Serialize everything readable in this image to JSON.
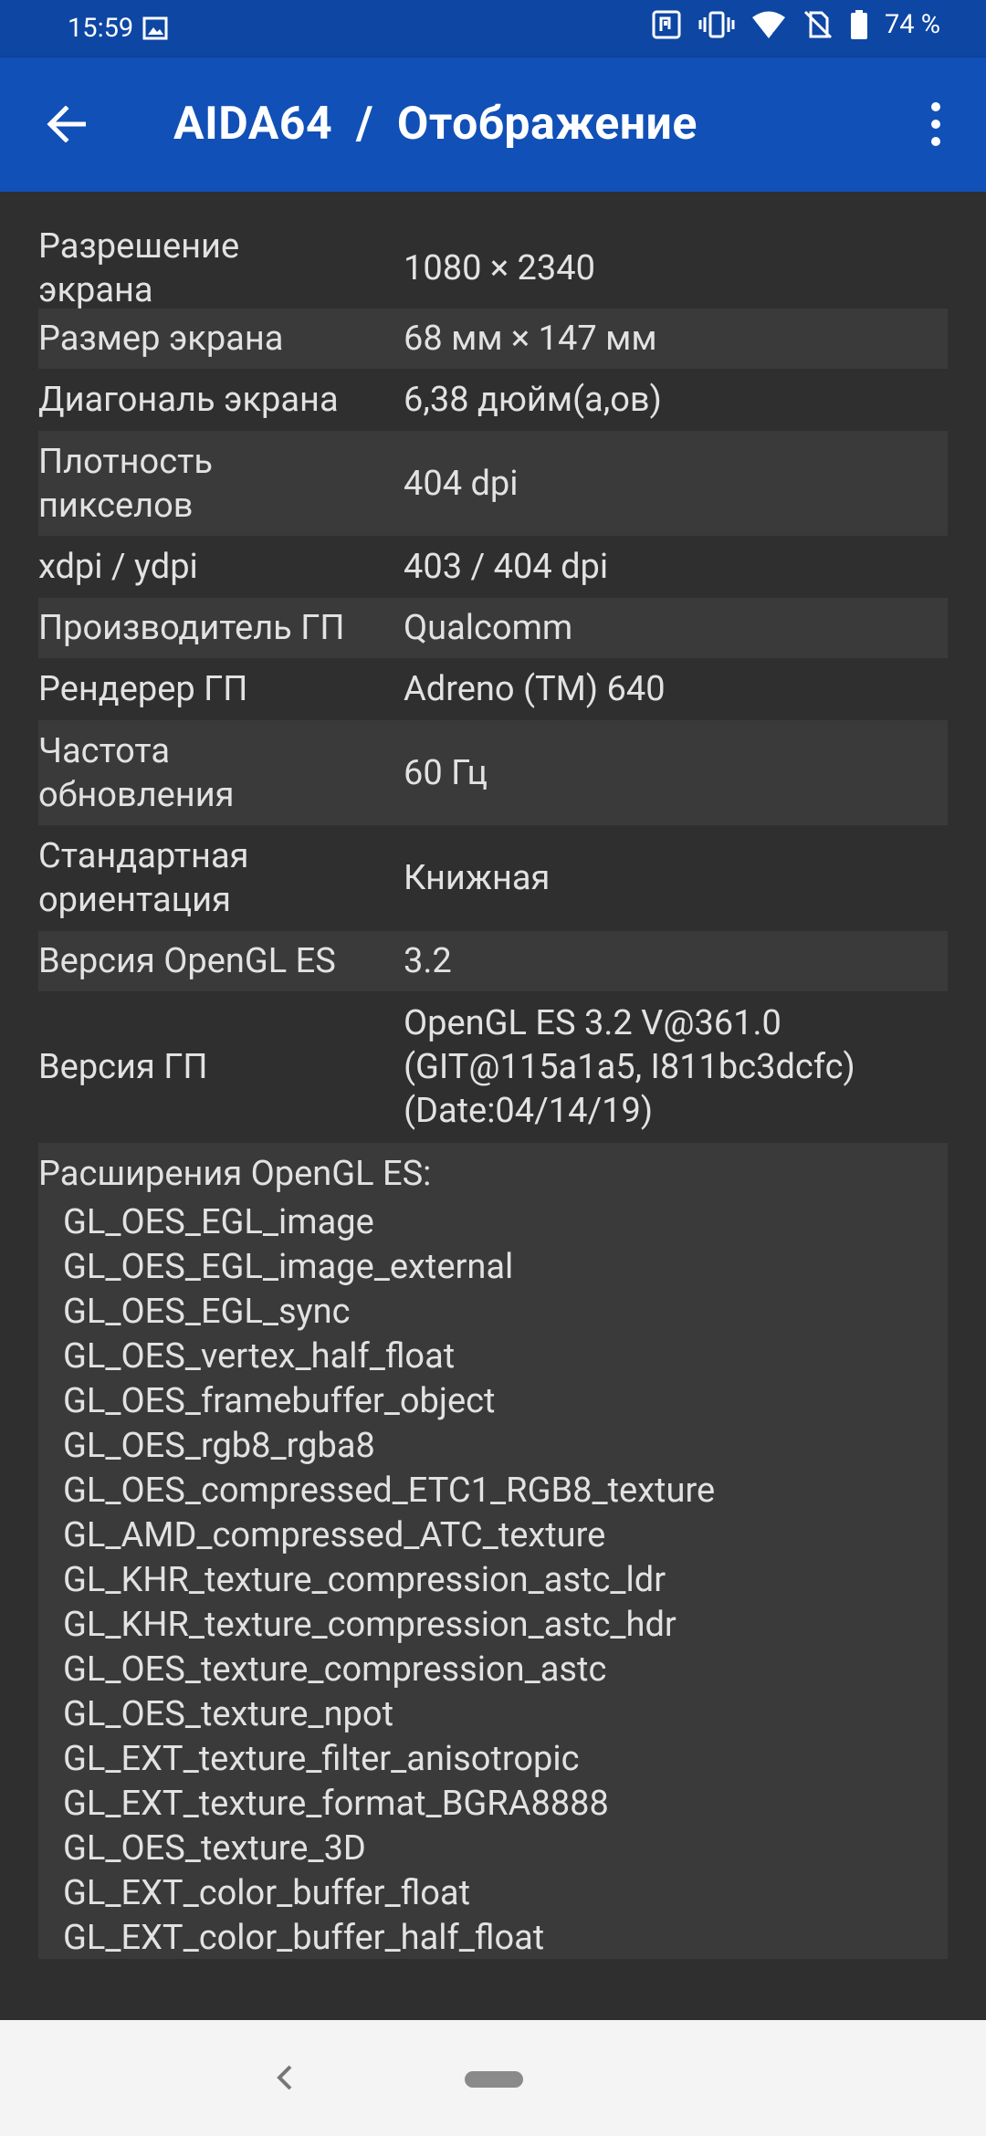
{
  "status_bar": {
    "time": "15:59",
    "battery": "74 %",
    "icons": [
      "gallery-icon",
      "nfc-icon",
      "vibrate-icon",
      "wifi-icon",
      "no-sim-icon",
      "battery-icon"
    ]
  },
  "app_bar": {
    "title": "AIDA64  /  Отображение",
    "back_icon": "arrow-left-icon",
    "menu_icon": "more-vert-icon"
  },
  "rows": [
    {
      "key": "Разрешение\nэкрана",
      "value": "1080 × 2340"
    },
    {
      "key": "Размер экрана",
      "value": "68 мм × 147 мм"
    },
    {
      "key": "Диагональ экрана",
      "value": "6,38 дюйм(а,ов)"
    },
    {
      "key": "Плотность\nпикселов",
      "value": "404 dpi"
    },
    {
      "key": "xdpi / ydpi",
      "value": "403 / 404 dpi"
    },
    {
      "key": "Производитель ГП",
      "value": "Qualcomm"
    },
    {
      "key": "Рендерер ГП",
      "value": "Adreno (TM) 640"
    },
    {
      "key": "Частота\nобновления",
      "value": "60 Гц"
    },
    {
      "key": "Стандартная\nориентация",
      "value": "Книжная"
    },
    {
      "key": "Версия OpenGL ES",
      "value": "3.2"
    },
    {
      "key": "Версия ГП",
      "value": "OpenGL ES 3.2 V@361.0\n(GIT@115a1a5, I811bc3dcfc)\n(Date:04/14/19)"
    }
  ],
  "extensions": {
    "header": "Расширения OpenGL ES:",
    "items": [
      "GL_OES_EGL_image",
      "GL_OES_EGL_image_external",
      "GL_OES_EGL_sync",
      "GL_OES_vertex_half_float",
      "GL_OES_framebuffer_object",
      "GL_OES_rgb8_rgba8",
      "GL_OES_compressed_ETC1_RGB8_texture",
      "GL_AMD_compressed_ATC_texture",
      "GL_KHR_texture_compression_astc_ldr",
      "GL_KHR_texture_compression_astc_hdr",
      "GL_OES_texture_compression_astc",
      "GL_OES_texture_npot",
      "GL_EXT_texture_filter_anisotropic",
      "GL_EXT_texture_format_BGRA8888",
      "GL_OES_texture_3D",
      "GL_EXT_color_buffer_float",
      "GL_EXT_color_buffer_half_float"
    ]
  },
  "nav_bar": {
    "icons": [
      "nav-back-icon",
      "home-pill-icon"
    ]
  }
}
